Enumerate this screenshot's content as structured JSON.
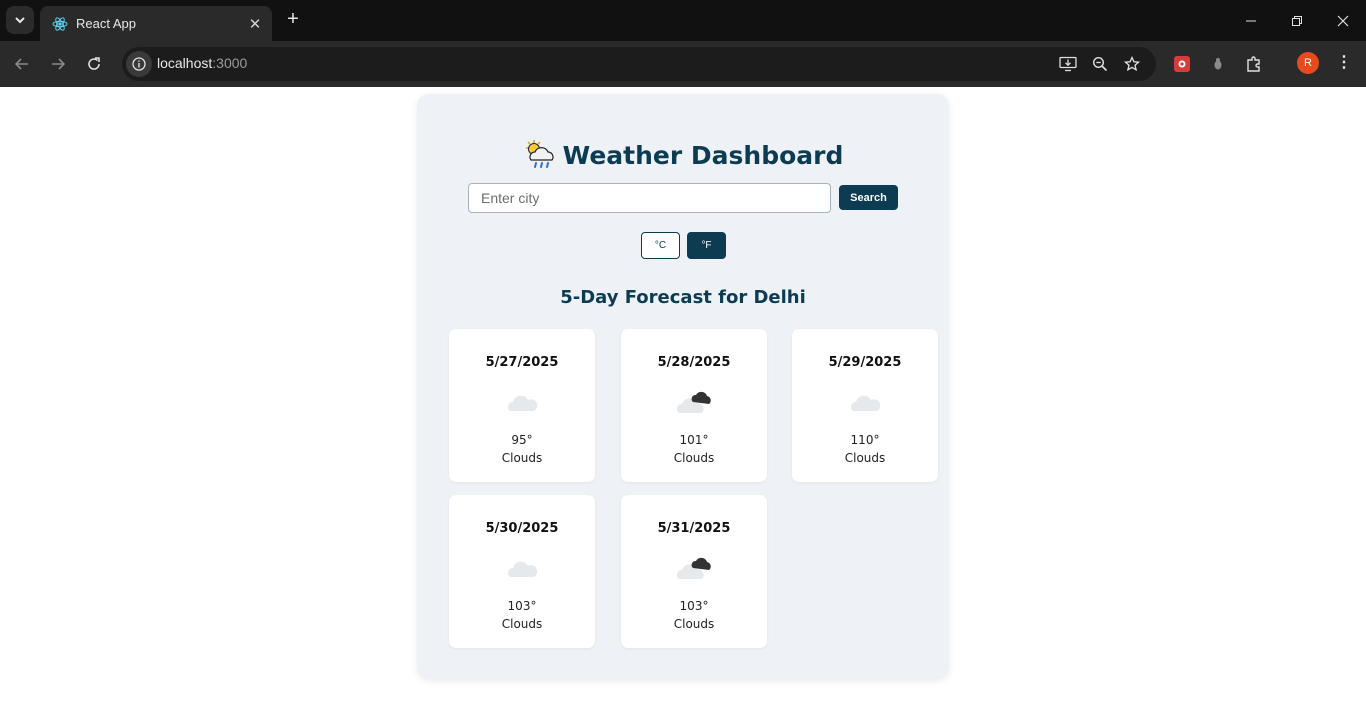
{
  "browser": {
    "tab_title": "React App",
    "url_host": "localhost",
    "url_port": ":3000",
    "profile_initial": "R"
  },
  "app": {
    "title": "Weather Dashboard",
    "search": {
      "placeholder": "Enter city",
      "button_label": "Search"
    },
    "units": {
      "celsius_label": "°C",
      "fahrenheit_label": "°F",
      "selected": "°F"
    },
    "forecast_title": "5-Day Forecast for Delhi",
    "forecast": [
      {
        "date": "5/27/2025",
        "temp": "95°",
        "desc": "Clouds",
        "icon": "few-clouds-icon"
      },
      {
        "date": "5/28/2025",
        "temp": "101°",
        "desc": "Clouds",
        "icon": "broken-clouds-icon"
      },
      {
        "date": "5/29/2025",
        "temp": "110°",
        "desc": "Clouds",
        "icon": "few-clouds-icon"
      },
      {
        "date": "5/30/2025",
        "temp": "103°",
        "desc": "Clouds",
        "icon": "few-clouds-icon"
      },
      {
        "date": "5/31/2025",
        "temp": "103°",
        "desc": "Clouds",
        "icon": "broken-clouds-icon"
      }
    ]
  },
  "colors": {
    "brand": "#0c3b52",
    "panel": "#eef2f7",
    "chrome_dark": "#2a2a2a"
  }
}
